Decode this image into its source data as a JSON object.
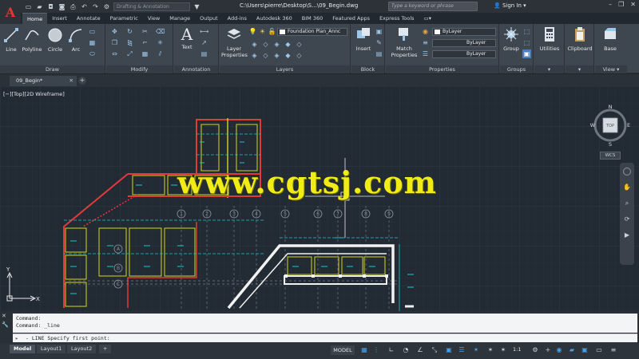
{
  "titlebar": {
    "workspace_hint": "Drafting & Annotation",
    "file_title": "C:\\Users\\pierre\\Desktop\\S...\\09_Begin.dwg",
    "search_placeholder": "Type a keyword or phrase",
    "sign_in": "Sign In"
  },
  "tabs": [
    "Home",
    "Insert",
    "Annotate",
    "Parametric",
    "View",
    "Manage",
    "Output",
    "Add-ins",
    "Autodesk 360",
    "BIM 360",
    "Featured Apps",
    "Express Tools"
  ],
  "ribbon": {
    "draw": {
      "label": "Draw",
      "tools": [
        "Line",
        "Polyline",
        "Circle",
        "Arc"
      ]
    },
    "modify": {
      "label": "Modify"
    },
    "annotation": {
      "label": "Annotation",
      "text": "Text"
    },
    "layers": {
      "label": "Layers",
      "layer_properties_1": "Layer",
      "layer_properties_2": "Properties",
      "current_layer": "Foundation Plan_Annc"
    },
    "block": {
      "label": "Block",
      "insert": "Insert"
    },
    "properties": {
      "label": "Properties",
      "match_1": "Match",
      "match_2": "Properties",
      "color": "ByLayer",
      "linetype": "ByLayer",
      "lineweight": "ByLayer"
    },
    "groups": {
      "label": "Groups",
      "group": "Group"
    },
    "utilities": {
      "label": "Utilities"
    },
    "clipboard": {
      "label": "Clipboard"
    },
    "view": {
      "label": "View",
      "base": "Base"
    }
  },
  "doc_tab": {
    "name": "09_Begin*"
  },
  "canvas": {
    "view_label": "[−][Top][2D Wireframe]",
    "watermark": "www.cgtsj.com",
    "viewcube": {
      "top": "TOP",
      "n": "N",
      "s": "S",
      "e": "E",
      "w": "W"
    },
    "wcs": "WCS",
    "ucs_x": "X",
    "ucs_y": "Y",
    "grid_bubbles": [
      "1",
      "2",
      "3",
      "4",
      "5",
      "6",
      "7",
      "8",
      "9"
    ],
    "grid_bubbles_left": [
      "A",
      "B",
      "C"
    ]
  },
  "command": {
    "history": [
      "Command:",
      "Command: _line"
    ],
    "prompt": "- LINE Specify first point:"
  },
  "status": {
    "layouts": [
      "Model",
      "Layout1",
      "Layout2"
    ],
    "model": "MODEL",
    "scale": "1:1"
  },
  "colors": {
    "accent": "#4aa0e8",
    "wall": "#e03a3a",
    "frame": "#d8d818",
    "dim": "#19c8c8",
    "watermark": "#f1ec16"
  }
}
